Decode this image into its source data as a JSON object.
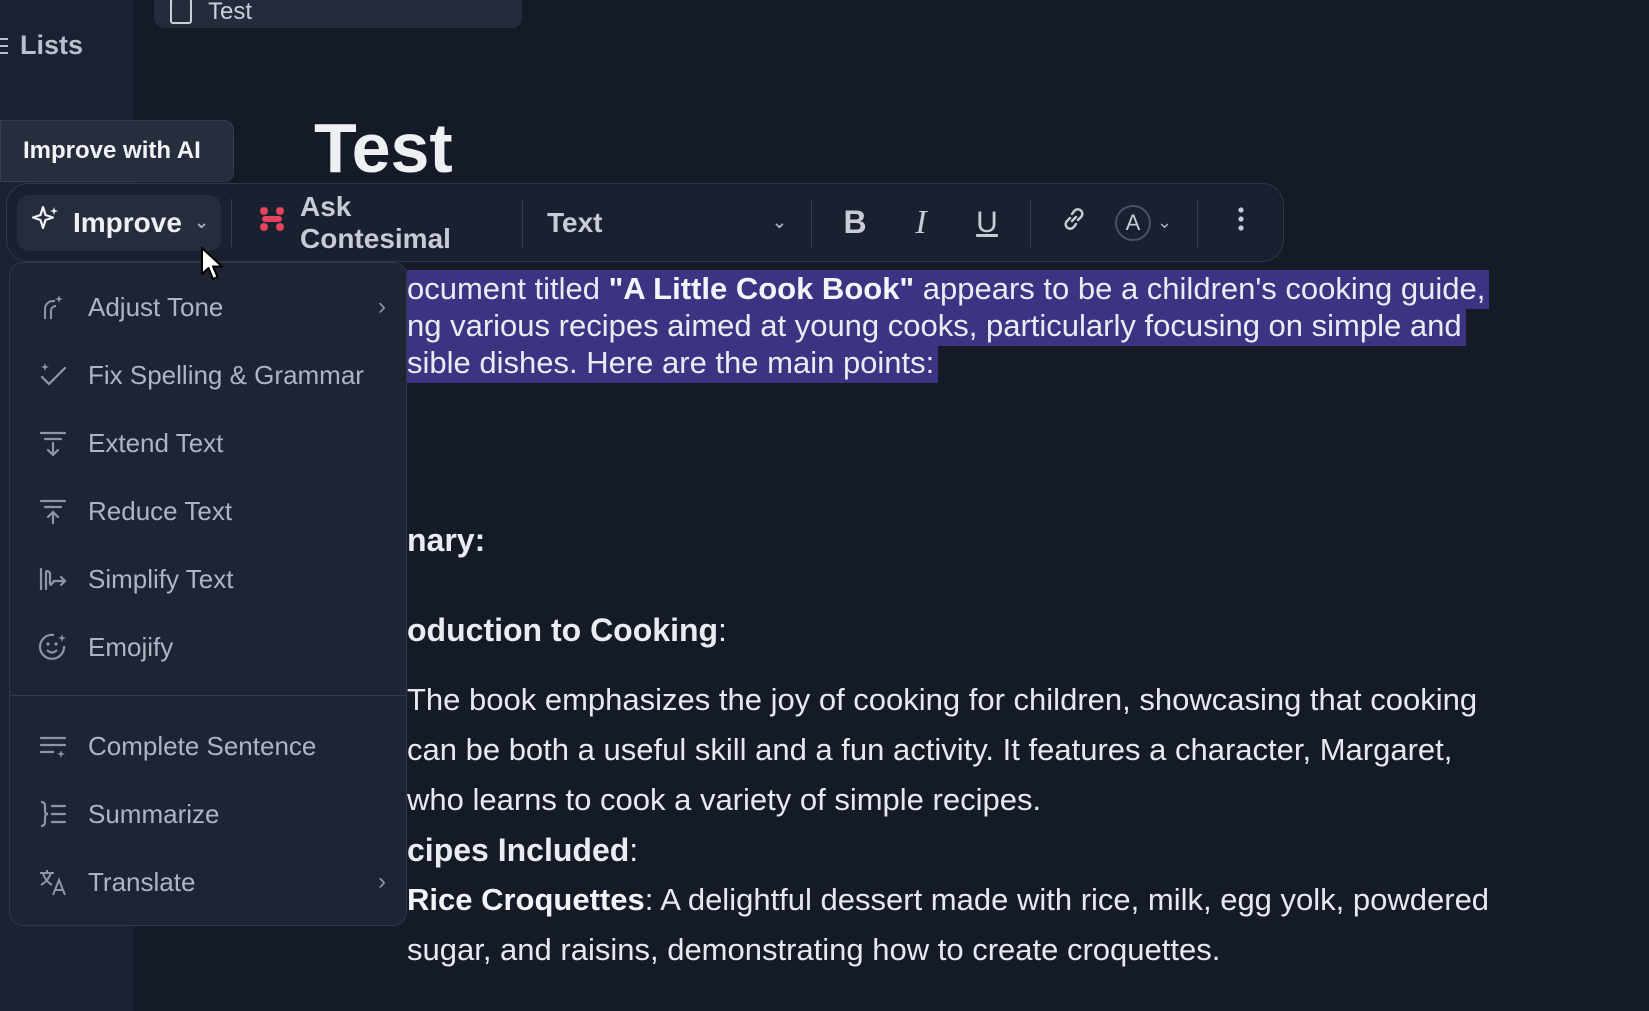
{
  "sidebar": {
    "lists_label": "Lists"
  },
  "doc_tab": {
    "label": "Test"
  },
  "tooltip": {
    "label": "Improve with AI"
  },
  "page": {
    "title": "Test"
  },
  "toolbar": {
    "improve_label": "Improve",
    "ask_label": "Ask Contesimal",
    "text_style_label": "Text",
    "bold": "B",
    "italic": "I",
    "underline": "U",
    "font_color": "A"
  },
  "menu": {
    "items": [
      {
        "label": "Adjust Tone",
        "icon": "tone-icon",
        "submenu": true
      },
      {
        "label": "Fix Spelling & Grammar",
        "icon": "spell-check-icon"
      },
      {
        "label": "Extend Text",
        "icon": "extend-text-icon"
      },
      {
        "label": "Reduce Text",
        "icon": "reduce-text-icon"
      },
      {
        "label": "Simplify Text",
        "icon": "simplify-icon"
      },
      {
        "label": "Emojify",
        "icon": "emoji-icon"
      }
    ],
    "items2": [
      {
        "label": "Complete Sentence",
        "icon": "complete-sentence-icon"
      },
      {
        "label": "Summarize",
        "icon": "summarize-icon"
      },
      {
        "label": "Translate",
        "icon": "translate-icon",
        "submenu": true
      }
    ]
  },
  "content": {
    "line1_a": "ocument titled ",
    "line1_b": "\"A Little Cook Book\"",
    "line1_c": " appears to be a children's cooking guide,",
    "line2": "ng various recipes aimed at young cooks, particularly focusing on simple and",
    "line3": "sible dishes. Here are the main points:",
    "summary_heading": "nary:",
    "intro_heading": "oduction to Cooking",
    "intro_colon": ":",
    "intro_line1": "The book emphasizes the joy of cooking for children, showcasing that cooking",
    "intro_line2": "can be both a useful skill and a fun activity. It features a character, Margaret,",
    "intro_line3": "who learns to cook a variety of simple recipes.",
    "recipes_heading": "cipes Included",
    "recipes_colon": ":",
    "rice_bold": "Rice Croquettes",
    "rice_text": ": A delightful dessert made with rice, milk, egg yolk, powdered",
    "rice_line2": "sugar, and raisins, demonstrating how to create croquettes."
  }
}
